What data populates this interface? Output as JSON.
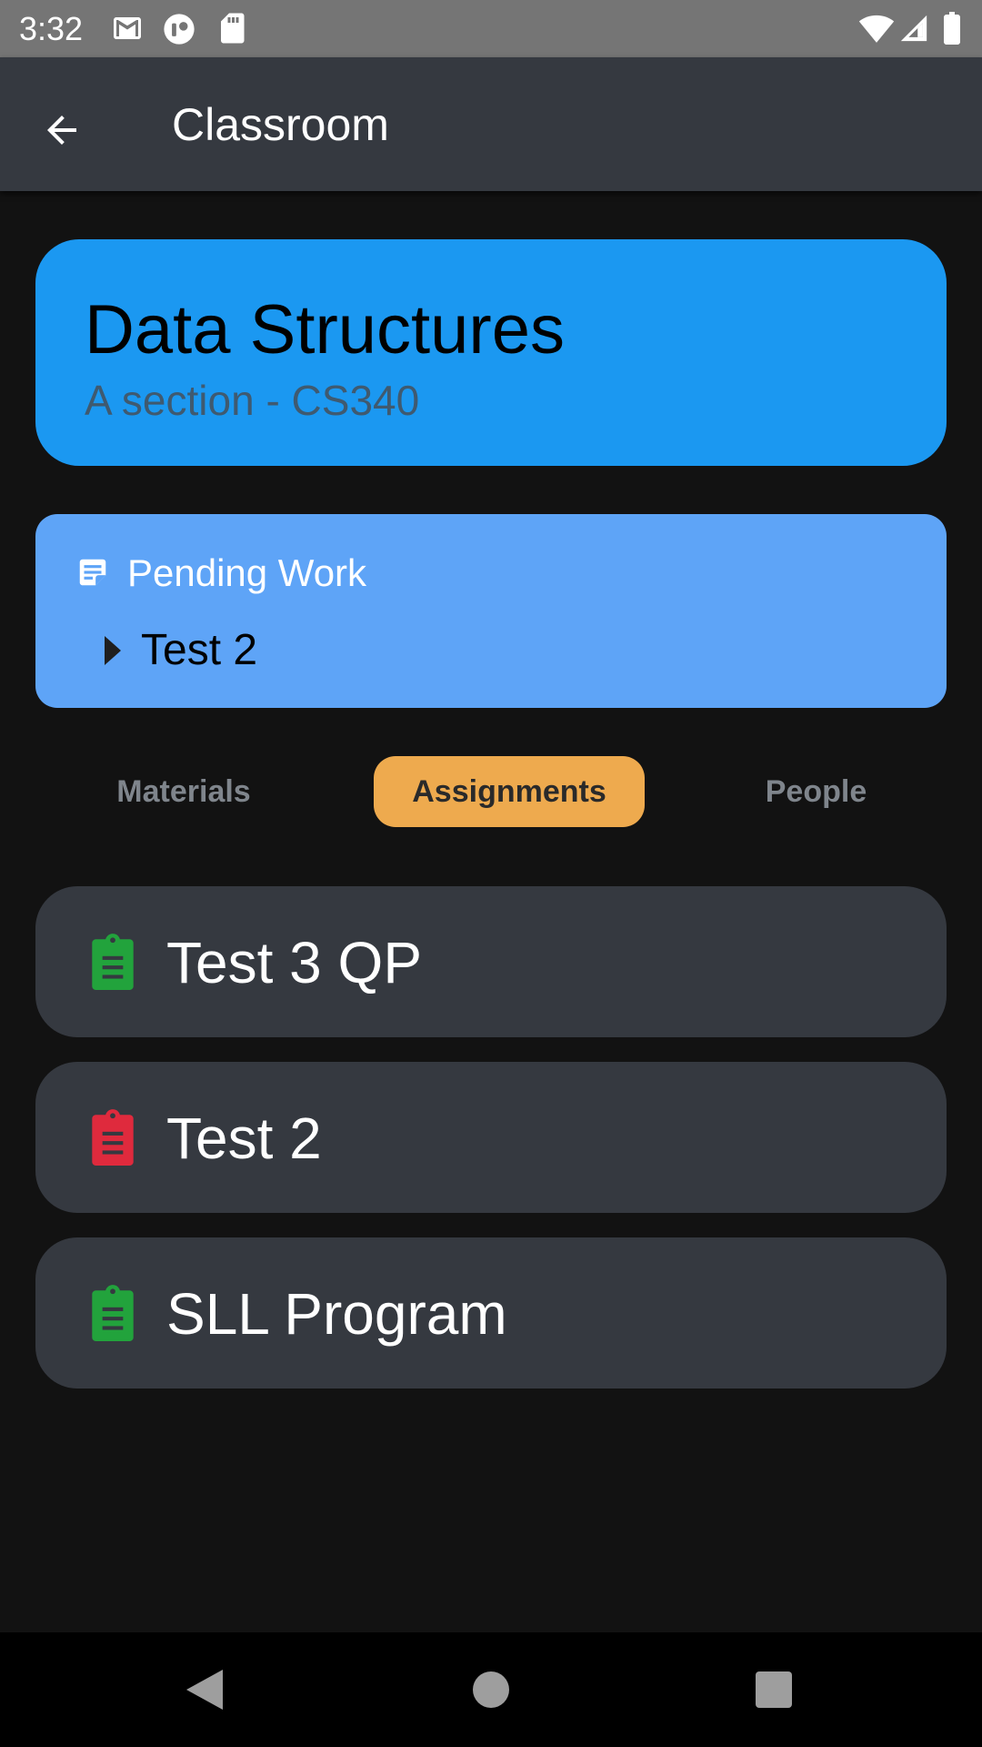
{
  "status_bar": {
    "time": "3:32",
    "icons": [
      "gmail-icon",
      "app-notification-icon",
      "sd-card-icon",
      "wifi-icon",
      "cellular-signal-icon",
      "battery-icon"
    ]
  },
  "app_bar": {
    "title": "Classroom",
    "back_icon": "arrow-back-icon"
  },
  "course": {
    "title": "Data Structures",
    "subtitle": "A section - CS340",
    "color": "#1b98f1"
  },
  "pending_work": {
    "label": "Pending Work",
    "icon": "note-icon",
    "items": [
      {
        "label": "Test 2"
      }
    ],
    "color": "#5ea4f7"
  },
  "tabs": [
    {
      "label": "Materials",
      "selected": false
    },
    {
      "label": "Assignments",
      "selected": true
    },
    {
      "label": "People",
      "selected": false
    }
  ],
  "tab_accent": "#eeaa4e",
  "assignments": [
    {
      "title": "Test 3 QP",
      "status": "submitted",
      "icon_color": "#22a33c"
    },
    {
      "title": "Test 2",
      "status": "pending",
      "icon_color": "#df2a3d"
    },
    {
      "title": "SLL Program",
      "status": "submitted",
      "icon_color": "#22a33c"
    }
  ],
  "nav_bar": {
    "buttons": [
      "back-triangle-icon",
      "home-circle-icon",
      "recents-square-icon"
    ]
  }
}
